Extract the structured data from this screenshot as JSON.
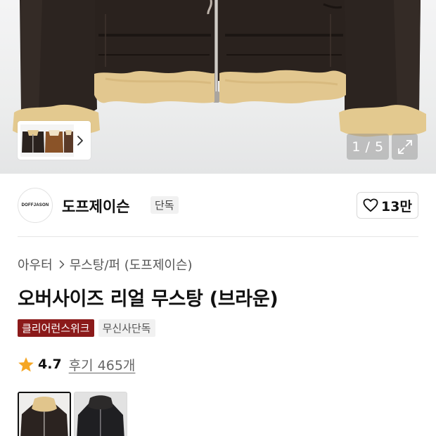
{
  "gallery": {
    "counter_current": "1",
    "counter_separator": "/",
    "counter_total": "5",
    "counter_text": "1 / 5"
  },
  "brand": {
    "logo_text": "DOFFJASON",
    "name": "도프제이슨",
    "badge": "단독",
    "like_count": "13만"
  },
  "breadcrumb": {
    "category": "아우터",
    "subcategory": "무스탕/퍼 (도프제이슨)"
  },
  "product": {
    "title": "오버사이즈 리얼 무스탕 (브라운)",
    "tags": [
      "클리어런스위크",
      "무신사단독"
    ],
    "rating": "4.7",
    "reviews": "후기 465개"
  },
  "colors": {
    "accent_red": "#8b1a1a",
    "star": "#f5a623",
    "leather": "#2b231f",
    "fur": "#e3c98f"
  },
  "icons": [
    "chevron-right-icon",
    "expand-icon",
    "heart-icon",
    "star-icon"
  ]
}
